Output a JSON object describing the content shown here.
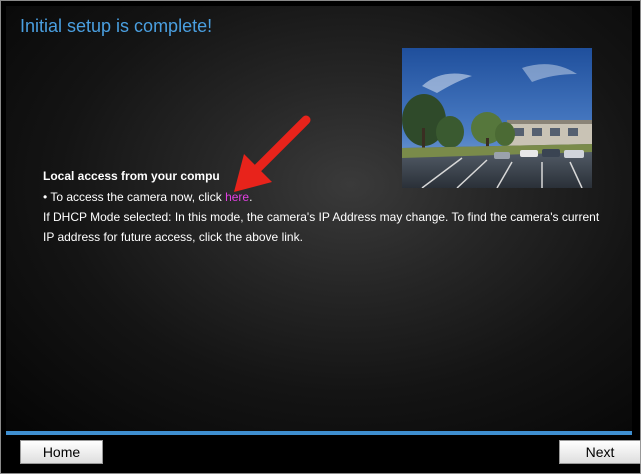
{
  "page": {
    "title": "Initial setup is complete!"
  },
  "local_access": {
    "heading": "Local access from your compu",
    "bullet_prefix": "• To access the camera now, click ",
    "link_text": "here",
    "bullet_suffix": ".",
    "dhcp_note": "If DHCP Mode selected: In this mode, the camera's IP Address may change. To find the camera's current IP address for future access, click the above link."
  },
  "buttons": {
    "home_label": "Home",
    "next_label": "Next"
  },
  "colors": {
    "title": "#4a9fe0",
    "link": "#e040e0",
    "accent_bar": "#3f8fd0",
    "arrow": "#e8231b"
  },
  "icons": {
    "arrow": "red-pointer-arrow"
  }
}
